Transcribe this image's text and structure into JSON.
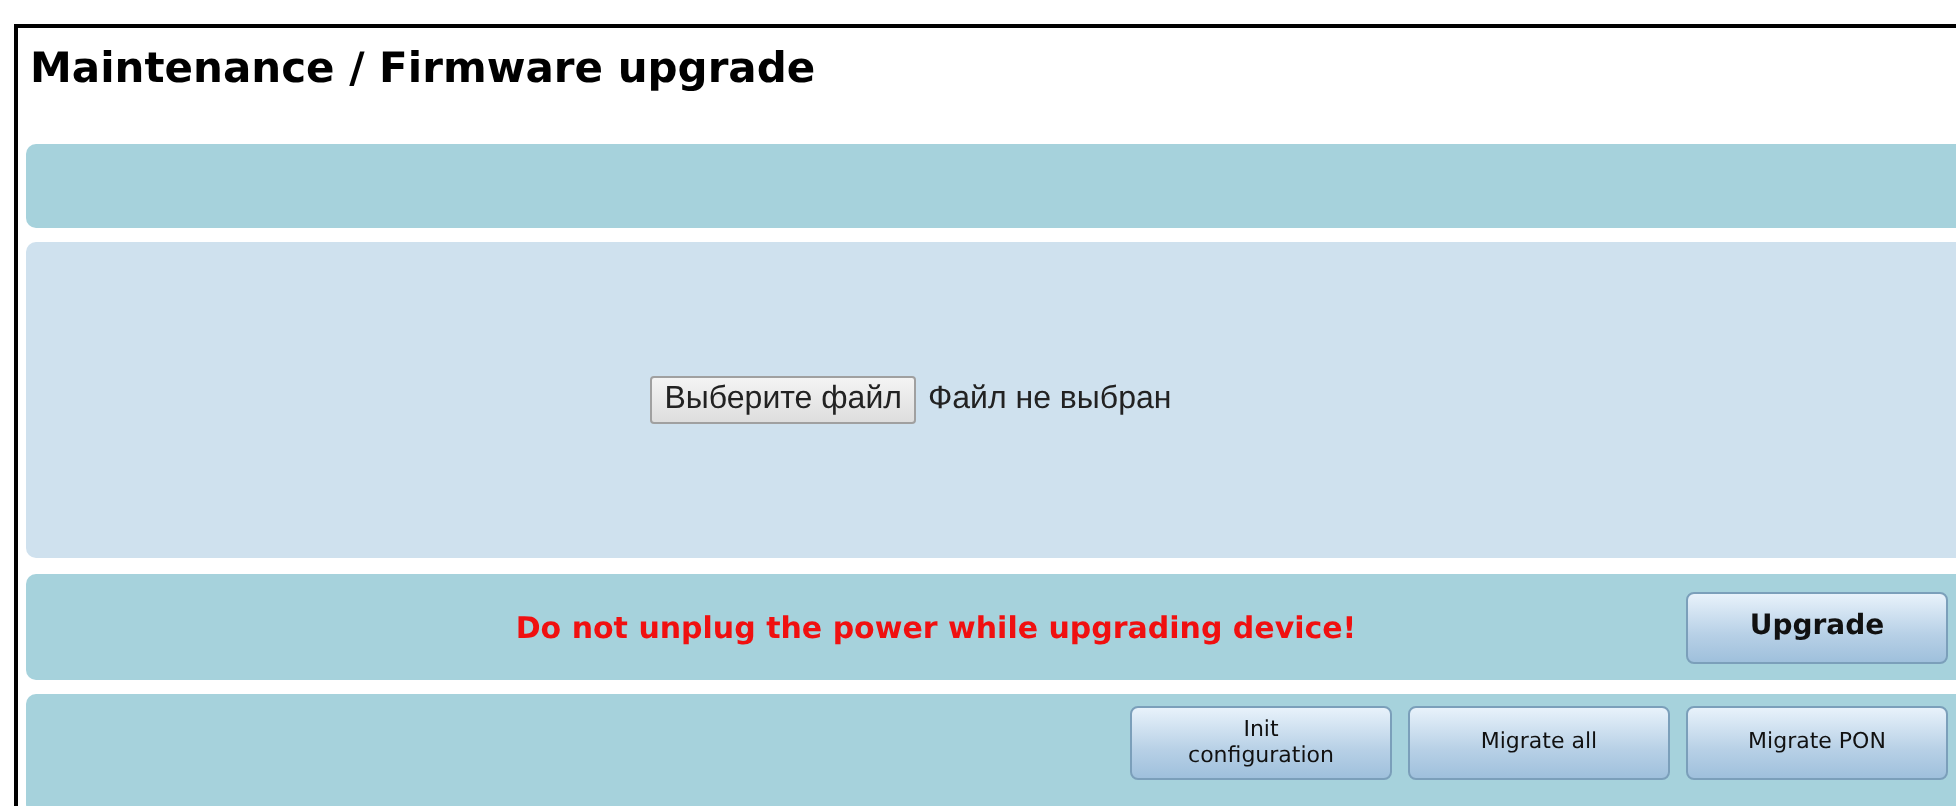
{
  "title": "Maintenance / Firmware upgrade",
  "file_picker": {
    "button": "Выберите файл",
    "status": "Файл не выбран"
  },
  "warning": "Do not unplug the power while upgrading device!",
  "upgrade_button": "Upgrade",
  "actions": [
    {
      "label": "Init\nconfiguration"
    },
    {
      "label": "Migrate all"
    },
    {
      "label": "Migrate PON"
    }
  ]
}
